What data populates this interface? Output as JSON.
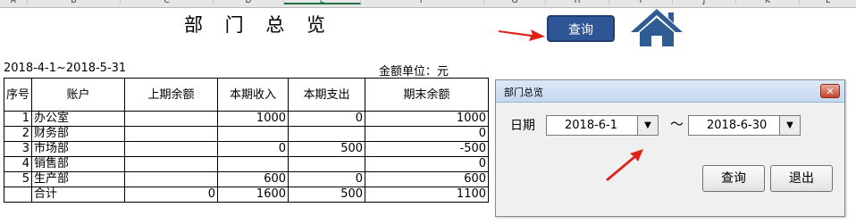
{
  "columns": [
    "A",
    "B",
    "C",
    "D",
    "E",
    "F",
    "G",
    "H",
    "I",
    "J",
    "K",
    "L"
  ],
  "sheet": {
    "title": "部 门 总 览",
    "date_range": "2018-4-1~2018-5-31",
    "unit": "金额单位：元",
    "query_button": "查询",
    "home_icon": "home-icon",
    "headers": {
      "seq": "序号",
      "account": "账户",
      "prev_balance": "上期余额",
      "income": "本期收入",
      "expense": "本期支出",
      "end_balance": "期末余额"
    },
    "rows": [
      {
        "seq": "1",
        "account": "办公室",
        "prev": "",
        "income": "1000",
        "expense": "0",
        "end": "1000"
      },
      {
        "seq": "2",
        "account": "财务部",
        "prev": "",
        "income": "",
        "expense": "",
        "end": "0"
      },
      {
        "seq": "3",
        "account": "市场部",
        "prev": "",
        "income": "0",
        "expense": "500",
        "end": "-500"
      },
      {
        "seq": "4",
        "account": "销售部",
        "prev": "",
        "income": "",
        "expense": "",
        "end": "0"
      },
      {
        "seq": "5",
        "account": "生产部",
        "prev": "",
        "income": "600",
        "expense": "0",
        "end": "600"
      }
    ],
    "total": {
      "label": "合计",
      "prev": "0",
      "income": "1600",
      "expense": "500",
      "end": "1100"
    }
  },
  "dialog": {
    "title": "部门总览",
    "close": "✕",
    "date_label": "日期",
    "start_date": "2018-6-1",
    "separator": "～",
    "end_date": "2018-6-30",
    "query_label": "查询",
    "exit_label": "退出"
  },
  "colors": {
    "button_blue": "#2e5596",
    "arrow_red": "#e0211b",
    "home_blue": "#2f5c92"
  }
}
